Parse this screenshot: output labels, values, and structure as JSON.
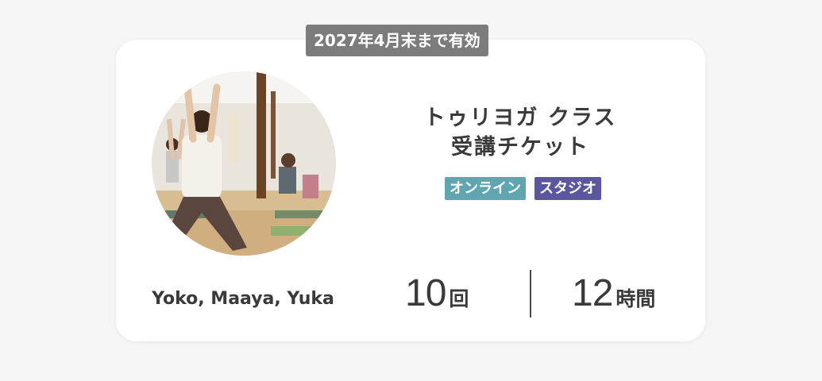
{
  "ticket": {
    "validity": "2027年4月末まで有効",
    "title_line1": "トゥリヨガ クラス",
    "title_line2": "受講チケット",
    "tags": [
      "オンライン",
      "スタジオ"
    ],
    "instructors": "Yoko, Maaya, Yuka",
    "count_value": "10",
    "count_unit": "回",
    "hours_value": "12",
    "hours_unit": "時間"
  },
  "colors": {
    "tag_online": "#5fa6b0",
    "tag_studio": "#5a56a0",
    "badge": "#7c7c7c",
    "text": "#3a3a3a"
  },
  "photo": {
    "icon": "yoga-class-photo"
  }
}
